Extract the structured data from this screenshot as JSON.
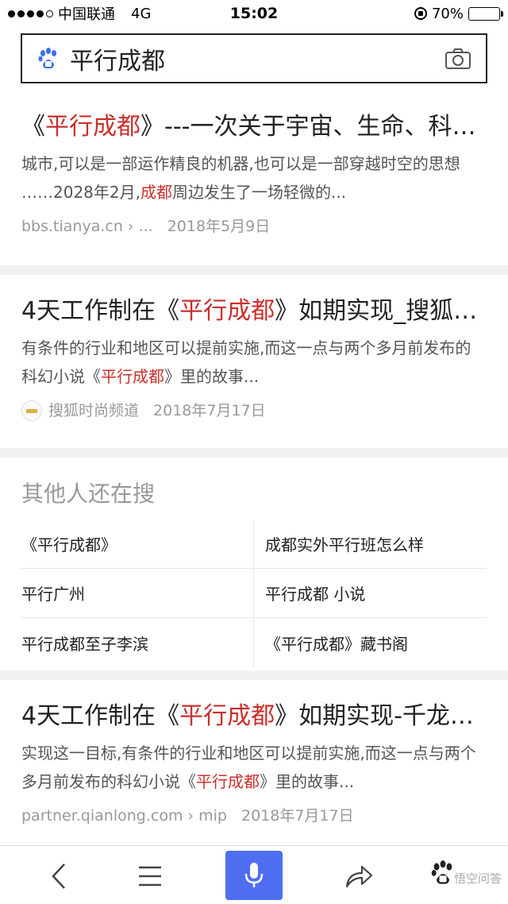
{
  "status_bar": {
    "carrier": "中国联通",
    "network": "4G",
    "time": "15:02",
    "battery": "70%",
    "battery_level": 0.7
  },
  "search": {
    "query": "平行成都"
  },
  "results": [
    {
      "title_pre": "《",
      "title_hl": "平行成都",
      "title_post": "》---一次关于宇宙、生命、科技…",
      "snippet_pre": "城市,可以是一部运作精良的机器,也可以是一部穿越时空的思想 ……2028年2月,",
      "snippet_hl": "成都",
      "snippet_post": "周边发生了一场轻微的...",
      "source": "bbs.tianya.cn › ...",
      "date": "2018年5月9日"
    },
    {
      "title_pre": "4天工作制在《",
      "title_hl": "平行成都",
      "title_post": "》如期实现_搜狐…",
      "snippet_pre": "有条件的行业和地区可以提前实施,而这一点与两个多月前发布的科幻小说《",
      "snippet_hl": "平行成都",
      "snippet_post": "》里的故事...",
      "source": "搜狐时尚频道",
      "date": "2018年7月17日"
    },
    {
      "title_pre": "4天工作制在《",
      "title_hl": "平行成都",
      "title_post": "》如期实现-千龙网…",
      "snippet_pre": "实现这一目标,有条件的行业和地区可以提前实施,而这一点与两个多月前发布的科幻小说《",
      "snippet_hl": "平行成都",
      "snippet_post": "》里的故事...",
      "source": "partner.qianlong.com › mip",
      "date": "2018年7月17日"
    }
  ],
  "related": {
    "title": "其他人还在搜",
    "items": [
      "《平行成都》",
      "成都实外平行班怎么样",
      "平行广州",
      "平行成都 小说",
      "平行成都至子李滨",
      "《平行成都》藏书阁"
    ]
  },
  "watermark": "悟空问答",
  "colors": {
    "highlight": "#c9302c",
    "mic_button": "#4e6ef2"
  }
}
